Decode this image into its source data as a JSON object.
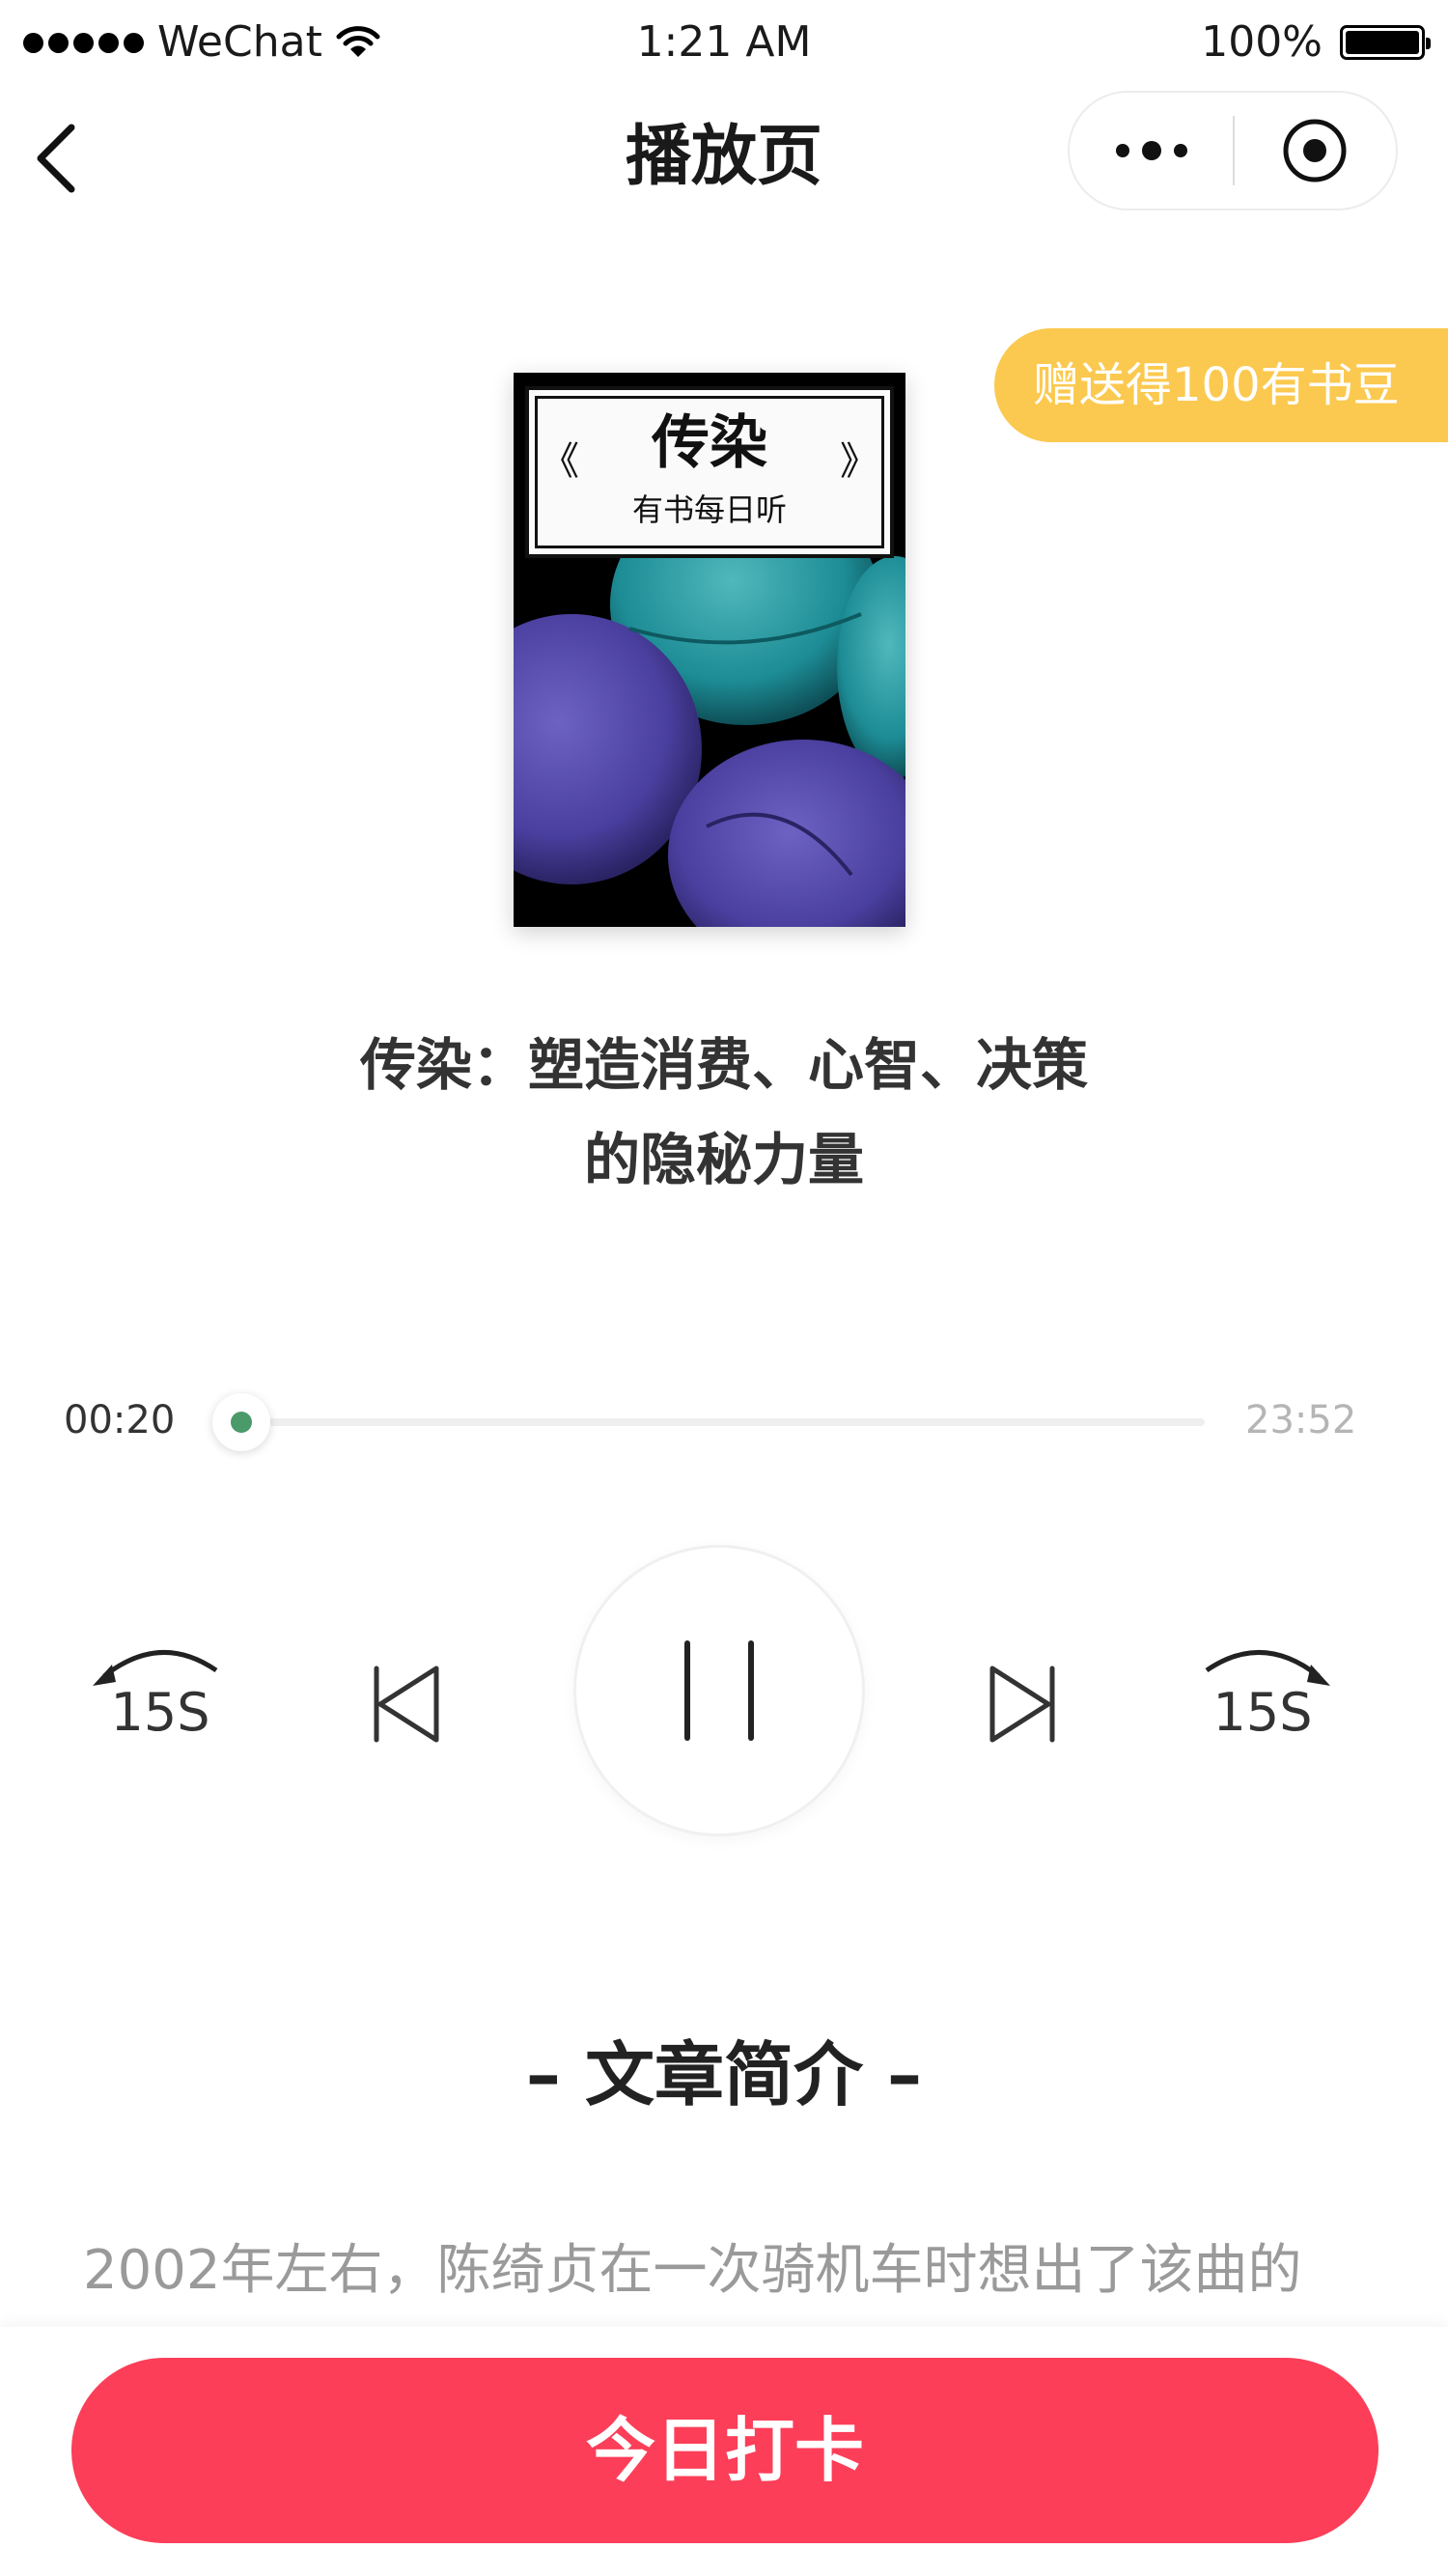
{
  "status_bar": {
    "carrier": "WeChat",
    "time": "1:21 AM",
    "battery_percent": "100%",
    "battery_level": 1.0,
    "icons": [
      "signal-dots-icon",
      "wifi-icon",
      "battery-icon"
    ]
  },
  "nav": {
    "title": "播放页",
    "icons": [
      "back-icon",
      "more-icon",
      "close-mini-program-icon"
    ]
  },
  "gift_badge": {
    "text": "赠送得100有书豆",
    "color": "#fbc94f"
  },
  "cover": {
    "title": "传染",
    "subtitle": "有书每日听",
    "quote_left": "《",
    "quote_right": "》"
  },
  "book": {
    "title_line1": "传染：塑造消费、心智、决策",
    "title_line2": "的隐秘力量"
  },
  "player": {
    "current_time": "00:20",
    "total_time": "23:52",
    "progress": 0.014,
    "accent_color": "#4a9a6a",
    "rewind_label": "15S",
    "forward_label": "15S",
    "state": "playing",
    "icons": [
      "rewind-15s-icon",
      "previous-track-icon",
      "pause-icon",
      "next-track-icon",
      "forward-15s-icon"
    ]
  },
  "intro": {
    "heading": "– 文章简介 –",
    "text": "2002年左右，陈绮贞在一次骑机车时想出了该曲的"
  },
  "bottom": {
    "checkin_label": "今日打卡",
    "button_color": "#fc3e58"
  }
}
